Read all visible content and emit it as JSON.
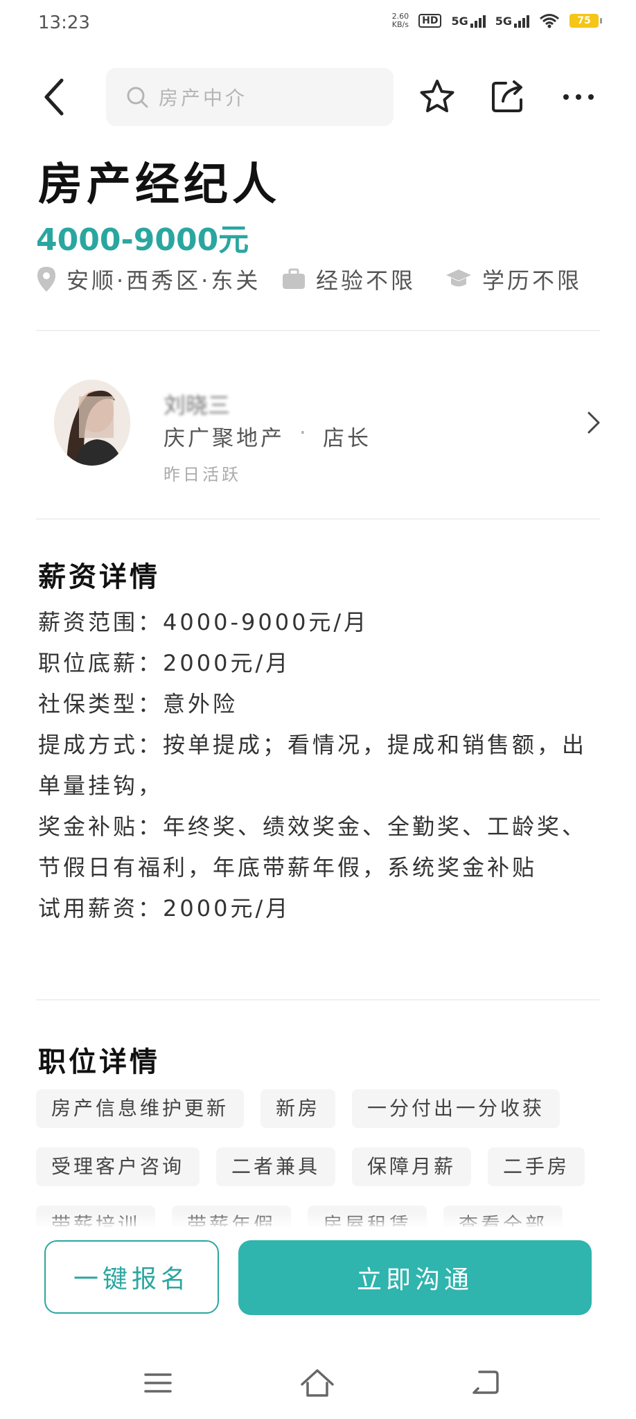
{
  "status_bar": {
    "time": "13:23",
    "net_speed_value": "2.60",
    "net_speed_unit": "KB/s",
    "hd_label": "HD",
    "sim1": "5G",
    "sim2": "5G",
    "battery": "75"
  },
  "header": {
    "search_placeholder": "房产中介"
  },
  "job": {
    "title": "房产经纪人",
    "salary": "4000-9000元",
    "location": "安顺·西秀区·东关",
    "experience": "经验不限",
    "education": "学历不限"
  },
  "recruiter": {
    "name": "刘晓三",
    "company": "庆广聚地产",
    "separator": "·",
    "role": "店长",
    "active": "昨日活跃"
  },
  "salary_details": {
    "heading": "薪资详情",
    "lines": [
      "薪资范围：4000-9000元/月",
      "职位底薪：2000元/月",
      "社保类型：意外险",
      "提成方式：按单提成；看情况，提成和销售额，出单量挂钩，",
      "奖金补贴：年终奖、绩效奖金、全勤奖、工龄奖、节假日有福利，年底带薪年假，系统奖金补贴",
      "试用薪资：2000元/月"
    ]
  },
  "position_details": {
    "heading": "职位详情",
    "tags": [
      "房产信息维护更新",
      "新房",
      "一分付出一分收获",
      "受理客户咨询",
      "二者兼具",
      "保障月薪",
      "二手房",
      "带薪培训",
      "带薪年假",
      "房屋租赁",
      "查看全部"
    ]
  },
  "actions": {
    "signup": "一键报名",
    "chat": "立即沟通"
  },
  "colors": {
    "accent": "#2aa6a0",
    "button": "#2fb4ae"
  }
}
